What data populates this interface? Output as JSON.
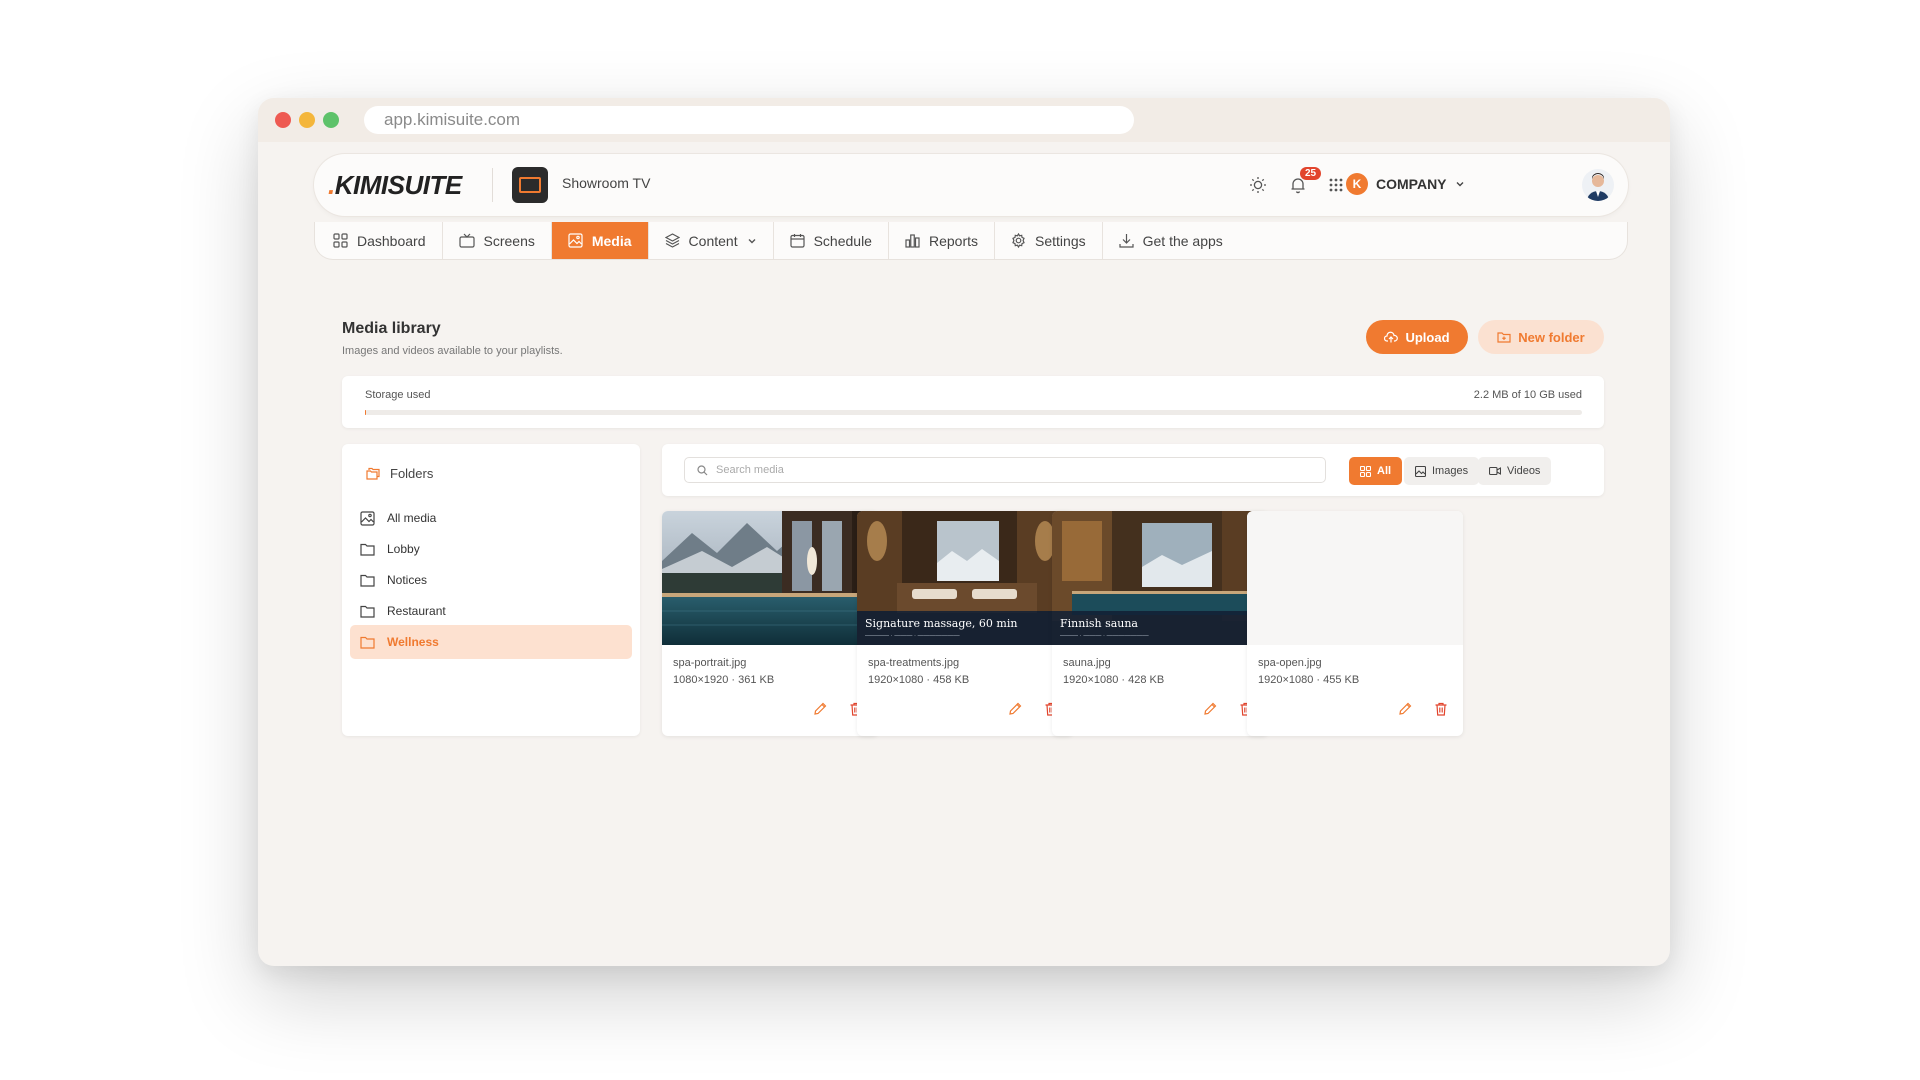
{
  "browser": {
    "url": "app.kimisuite.com"
  },
  "header": {
    "logo_dot": ".",
    "logo_text": "KIMISUITE",
    "screen_name": "Showroom TV",
    "company_initial": "K",
    "company_label": "COMPANY",
    "notification_count": "25"
  },
  "nav": {
    "items": [
      {
        "label": "Dashboard",
        "icon": "dashboard-icon"
      },
      {
        "label": "Screens",
        "icon": "tv-icon"
      },
      {
        "label": "Media",
        "icon": "image-icon",
        "active": true
      },
      {
        "label": "Content",
        "icon": "layers-icon"
      },
      {
        "label": "Schedule",
        "icon": "calendar-icon"
      },
      {
        "label": "Reports",
        "icon": "bar-chart-icon"
      },
      {
        "label": "Settings",
        "icon": "gear-icon"
      },
      {
        "label": "Get the apps",
        "icon": "download-icon"
      }
    ]
  },
  "page": {
    "title": "Media library",
    "subtitle": "Images and videos available to your playlists.",
    "upload_label": "Upload",
    "new_folder_label": "New folder"
  },
  "storage": {
    "label": "Storage used",
    "value": "2.2 MB of 10 GB used",
    "fraction": 0.0002
  },
  "folders": {
    "title": "Folders",
    "items": [
      {
        "label": "All media",
        "icon": "image-icon"
      },
      {
        "label": "Lobby",
        "icon": "folder-icon"
      },
      {
        "label": "Notices",
        "icon": "folder-icon"
      },
      {
        "label": "Restaurant",
        "icon": "folder-icon"
      },
      {
        "label": "Wellness",
        "icon": "folder-icon",
        "active": true
      }
    ]
  },
  "toolbar": {
    "search_placeholder": "Search media",
    "filters": [
      {
        "label": "All",
        "active": true
      },
      {
        "label": "Images"
      },
      {
        "label": "Videos"
      }
    ]
  },
  "media": [
    {
      "name": "spa-portrait.jpg",
      "meta": "1080×1920 · 361 KB",
      "caption": ""
    },
    {
      "name": "spa-treatments.jpg",
      "meta": "1920×1080 · 458 KB",
      "caption": "Signature massage, 60 min"
    },
    {
      "name": "sauna.jpg",
      "meta": "1920×1080 · 428 KB",
      "caption": "Finnish sauna"
    },
    {
      "name": "spa-open.jpg",
      "meta": "1920×1080 · 455 KB",
      "caption": ""
    }
  ],
  "colors": {
    "accent": "#f07a30",
    "accent_soft": "#fde1d0",
    "badge": "#e2452d"
  }
}
